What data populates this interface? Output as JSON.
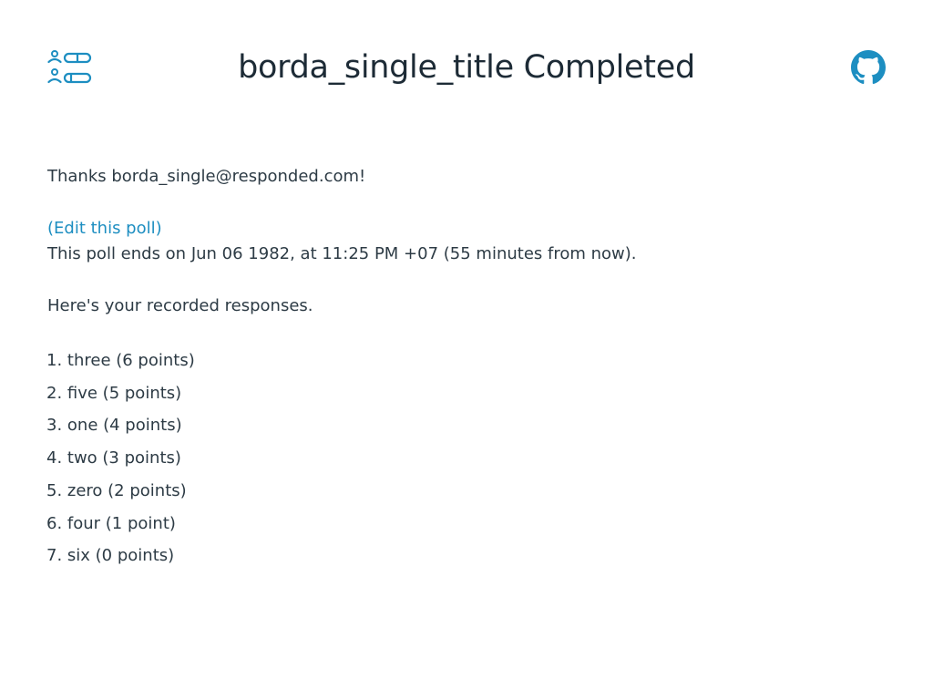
{
  "header": {
    "title": "borda_single_title Completed",
    "logo_icon": "poll-logo-icon",
    "github_icon": "github-icon",
    "accent_color": "#1d8ec1"
  },
  "content": {
    "thanks": "Thanks borda_single@responded.com!",
    "edit_link": "(Edit this poll)",
    "ends": "This poll ends on Jun 06 1982, at 11:25 PM +07 (55 minutes from now).",
    "recorded": "Here's your recorded responses.",
    "responses": [
      "1. three (6 points)",
      "2. five (5 points)",
      "3. one (4 points)",
      "4. two (3 points)",
      "5. zero (2 points)",
      "6. four (1 point)",
      "7. six (0 points)"
    ]
  }
}
